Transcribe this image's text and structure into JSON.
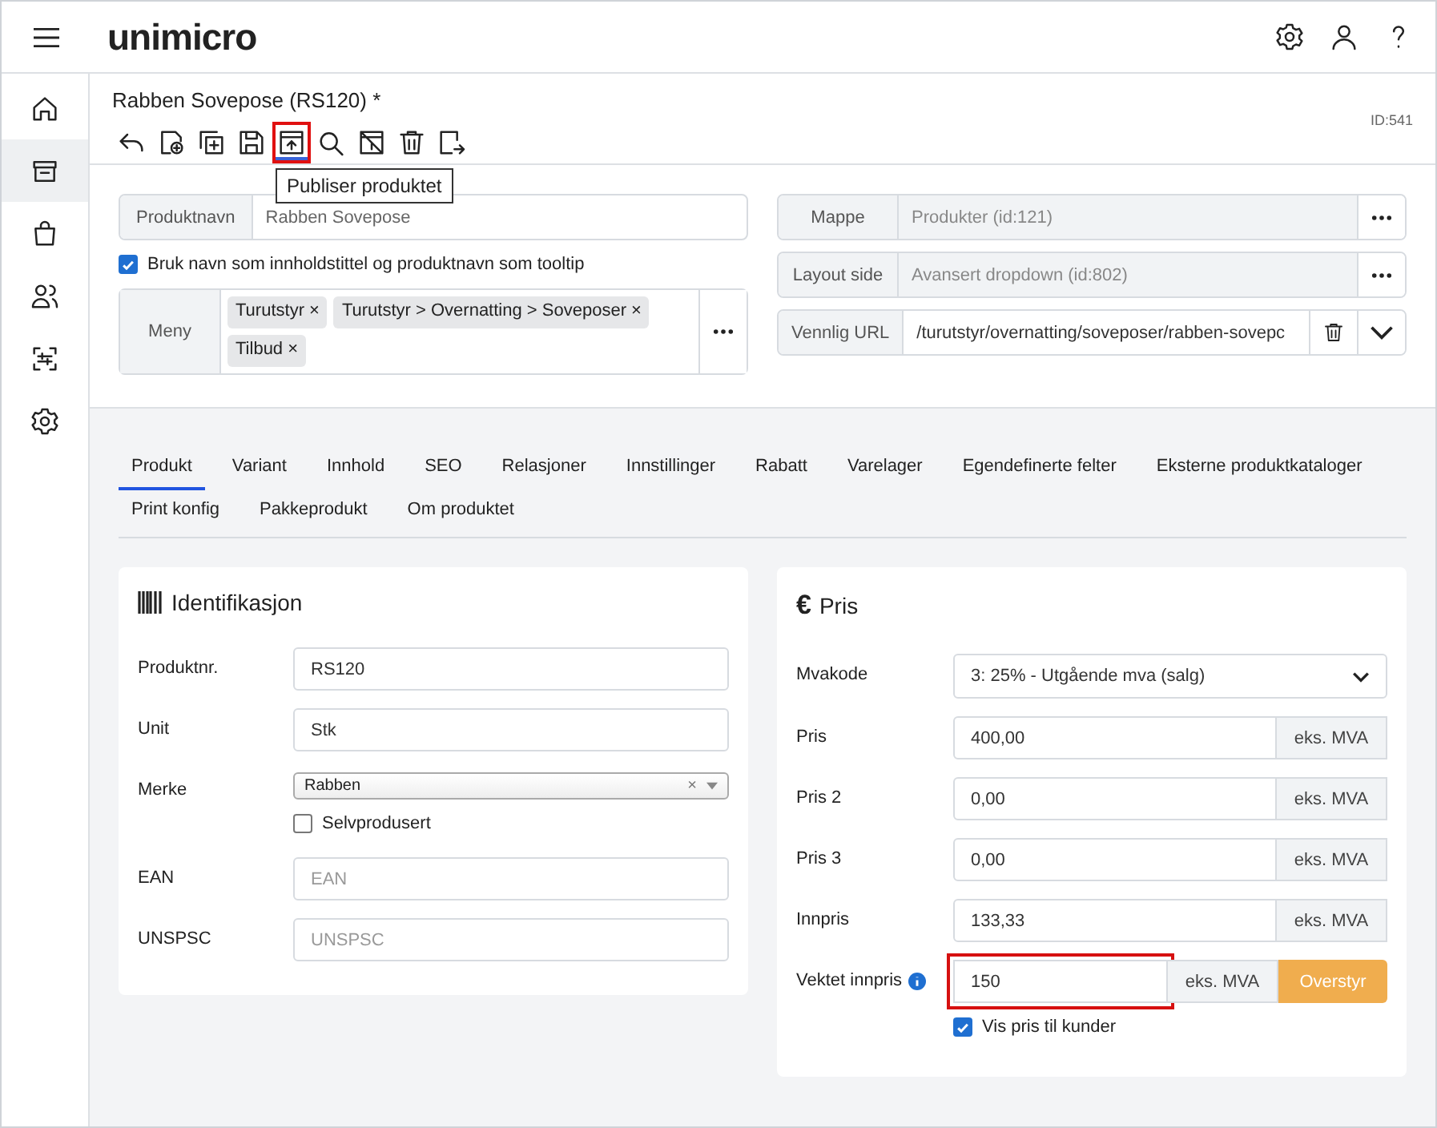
{
  "app": {
    "logo": "unimicro",
    "header_icons": [
      {
        "kind": "settings"
      },
      {
        "kind": "user"
      },
      {
        "kind": "help"
      }
    ]
  },
  "sidebar": {
    "items": [
      {
        "kind": "home",
        "selected": false
      },
      {
        "kind": "archive",
        "selected": true
      },
      {
        "kind": "bag",
        "selected": false
      },
      {
        "kind": "users",
        "selected": false
      },
      {
        "kind": "scan",
        "selected": false
      },
      {
        "kind": "settings",
        "selected": false
      }
    ]
  },
  "header": {
    "title": "Rabben Sovepose (RS120)",
    "dirty_mark": "*",
    "id_label": "ID:541"
  },
  "toolbar": [
    {
      "kind": "undo",
      "active": false,
      "highlighted": false
    },
    {
      "kind": "new",
      "active": false,
      "highlighted": false
    },
    {
      "kind": "copy",
      "active": false,
      "highlighted": false
    },
    {
      "kind": "save",
      "active": false,
      "highlighted": false
    },
    {
      "kind": "publish",
      "active": true,
      "highlighted": true
    },
    {
      "kind": "preview",
      "active": false,
      "highlighted": false
    },
    {
      "kind": "unpublish",
      "active": false,
      "highlighted": false
    },
    {
      "kind": "delete",
      "active": false,
      "highlighted": false
    },
    {
      "kind": "export",
      "active": false,
      "highlighted": false
    }
  ],
  "tooltip": "Publiser produktet",
  "product_name": {
    "label": "Produktnavn",
    "value": "Rabben Sovepose"
  },
  "use_name_checkbox": {
    "label": "Bruk navn som innholdstittel og produktnavn som tooltip",
    "checked": true
  },
  "menu": {
    "label": "Meny",
    "tags": [
      "Turutstyr",
      "Turutstyr > Overnatting > Soveposer",
      "Tilbud"
    ],
    "remove_mark": "×"
  },
  "folder": {
    "label": "Mappe",
    "value": "Produkter (id:121)"
  },
  "layout_page": {
    "label": "Layout side",
    "value": "Avansert dropdown (id:802)"
  },
  "friendly_url": {
    "label": "Vennlig URL",
    "value": "/turutstyr/overnatting/soveposer/rabben-sovepc"
  },
  "tabs": [
    {
      "label": "Produkt",
      "selected": true
    },
    {
      "label": "Variant",
      "selected": false
    },
    {
      "label": "Innhold",
      "selected": false
    },
    {
      "label": "SEO",
      "selected": false
    },
    {
      "label": "Relasjoner",
      "selected": false
    },
    {
      "label": "Innstillinger",
      "selected": false
    },
    {
      "label": "Rabatt",
      "selected": false
    },
    {
      "label": "Varelager",
      "selected": false
    },
    {
      "label": "Egendefinerte felter",
      "selected": false
    },
    {
      "label": "Eksterne produktkataloger",
      "selected": false
    },
    {
      "label": "Print konfig",
      "selected": false
    },
    {
      "label": "Pakkeprodukt",
      "selected": false
    },
    {
      "label": "Om produktet",
      "selected": false
    }
  ],
  "identification": {
    "title": "Identifikasjon",
    "fields": [
      {
        "kind": "text",
        "label": "Produktnr.",
        "value": "RS120"
      },
      {
        "kind": "text",
        "label": "Unit",
        "value": "Stk"
      },
      {
        "kind": "select",
        "label": "Merke",
        "value": "Rabben",
        "clear_mark": "×"
      },
      {
        "kind": "checkbox",
        "label": "Selvprodusert",
        "checked": false
      },
      {
        "kind": "text",
        "label": "EAN",
        "placeholder": "EAN"
      },
      {
        "kind": "text",
        "label": "UNSPSC",
        "placeholder": "UNSPSC"
      }
    ]
  },
  "price": {
    "title": "Pris",
    "currency_mark": "€",
    "fields": [
      {
        "kind": "select",
        "label": "Mvakode",
        "value": "3: 25% - Utgående mva (salg)"
      },
      {
        "kind": "amount",
        "label": "Pris",
        "value": "400,00",
        "suffix": "eks. MVA"
      },
      {
        "kind": "amount",
        "label": "Pris 2",
        "value": "0,00",
        "suffix": "eks. MVA"
      },
      {
        "kind": "amount",
        "label": "Pris 3",
        "value": "0,00",
        "suffix": "eks. MVA"
      },
      {
        "kind": "amount",
        "label": "Innpris",
        "value": "133,33",
        "suffix": "eks. MVA"
      },
      {
        "kind": "override",
        "label": "Vektet innpris",
        "value": "150",
        "suffix": "eks. MVA",
        "button": "Overstyr",
        "info": true,
        "highlighted": true
      },
      {
        "kind": "checkbox",
        "label": "Vis pris til kunder",
        "checked": true
      }
    ]
  }
}
